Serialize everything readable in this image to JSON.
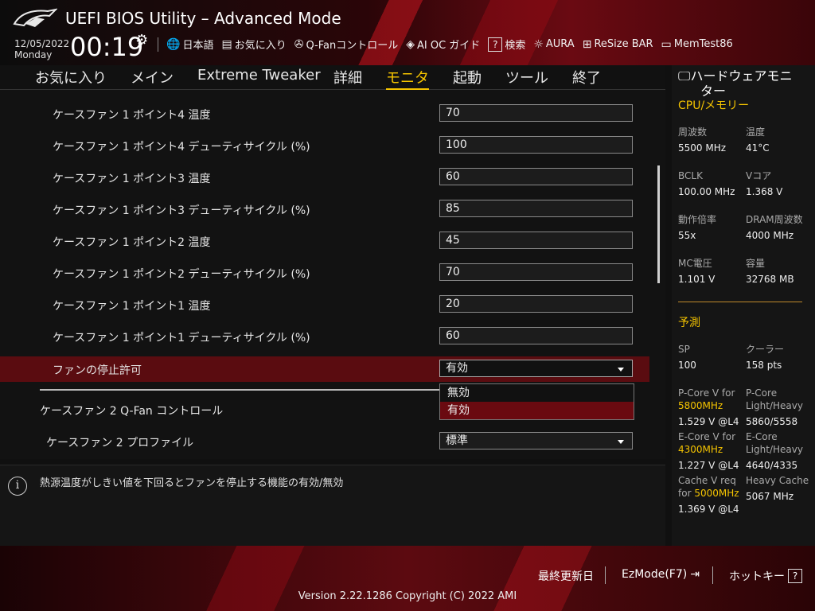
{
  "header": {
    "title": "UEFI BIOS Utility – Advanced Mode",
    "date": "12/05/2022",
    "day": "Monday",
    "time": "00:19"
  },
  "toolbar": [
    {
      "icon": "globe-icon",
      "label": "日本語"
    },
    {
      "icon": "favorites-icon",
      "label": "お気に入り"
    },
    {
      "icon": "fan-icon",
      "label": "Q-Fanコントロール"
    },
    {
      "icon": "chip-icon",
      "label": "AI OC ガイド"
    },
    {
      "icon": "help-icon",
      "label": "検索"
    },
    {
      "icon": "aura-icon",
      "label": "AURA"
    },
    {
      "icon": "resize-bar-icon",
      "label": "ReSize BAR"
    },
    {
      "icon": "memtest-icon",
      "label": "MemTest86"
    }
  ],
  "nav": {
    "tabs": [
      "お気に入り",
      "メイン",
      "Extreme Tweaker",
      "詳細",
      "モニタ",
      "起動",
      "ツール",
      "終了"
    ],
    "active": "モニタ"
  },
  "settings": [
    {
      "label": "ケースファン 1 ポイント4 温度",
      "value": "70"
    },
    {
      "label": "ケースファン 1 ポイント4 デューティサイクル (%)",
      "value": "100"
    },
    {
      "label": "ケースファン 1 ポイント3 温度",
      "value": "60"
    },
    {
      "label": "ケースファン 1 ポイント3 デューティサイクル (%)",
      "value": "85"
    },
    {
      "label": "ケースファン 1 ポイント2 温度",
      "value": "45"
    },
    {
      "label": "ケースファン 1 ポイント2 デューティサイクル (%)",
      "value": "70"
    },
    {
      "label": "ケースファン 1 ポイント1 温度",
      "value": "20"
    },
    {
      "label": "ケースファン 1 ポイント1 デューティサイクル (%)",
      "value": "60"
    }
  ],
  "fan_stop": {
    "label": "ファンの停止許可",
    "value": "有効",
    "options": [
      "無効",
      "有効"
    ]
  },
  "fan2": {
    "qfan_label": "ケースファン 2 Q-Fan コントロール",
    "profile_label": "ケースファン 2 プロファイル",
    "profile_value": "標準"
  },
  "help": {
    "text": "熱源温度がしきい値を下回るとファンを停止する機能の有効/無効"
  },
  "hw_monitor": {
    "title_line1": "ハードウェアモニ",
    "title_line2": "ター",
    "cpu_section": "CPU/メモリー",
    "freq_label": "周波数",
    "freq": "5500 MHz",
    "temp_label": "温度",
    "temp": "41°C",
    "bclk_label": "BCLK",
    "bclk": "100.00 MHz",
    "vcore_label": "Vコア",
    "vcore": "1.368 V",
    "ratio_label": "動作倍率",
    "ratio": "55x",
    "dram_label": "DRAM周波数",
    "dram": "4000 MHz",
    "mc_label": "MC電圧",
    "mc": "1.101 V",
    "cap_label": "容量",
    "cap": "32768 MB",
    "predict_section": "予測",
    "sp_label": "SP",
    "sp": "100",
    "cooler_label": "クーラー",
    "cooler": "158 pts",
    "pcore_v_label": "P-Core V for",
    "pcore_v_freq": "5800MHz",
    "pcore_v": "1.529 V @L4",
    "pcore_lh_label1": "P-Core",
    "pcore_lh_label2": "Light/Heavy",
    "pcore_lh": "5860/5558",
    "ecore_v_label": "E-Core V for",
    "ecore_v_freq": "4300MHz",
    "ecore_v": "1.227 V @L4",
    "ecore_lh_label1": "E-Core",
    "ecore_lh_label2": "Light/Heavy",
    "ecore_lh": "4640/4335",
    "cache_v_label1": "Cache V req",
    "cache_v_label2": "for",
    "cache_v_freq": "5000MHz",
    "cache_v": "1.369 V @L4",
    "heavy_cache_label": "Heavy Cache",
    "heavy_cache": "5067 MHz"
  },
  "footer": {
    "last_modified": "最終更新日",
    "ezmode": "EzMode(F7)",
    "hotkey": "ホットキー",
    "hotkey_icon_text": "?",
    "version": "Version 2.22.1286 Copyright (C) 2022 AMI"
  }
}
